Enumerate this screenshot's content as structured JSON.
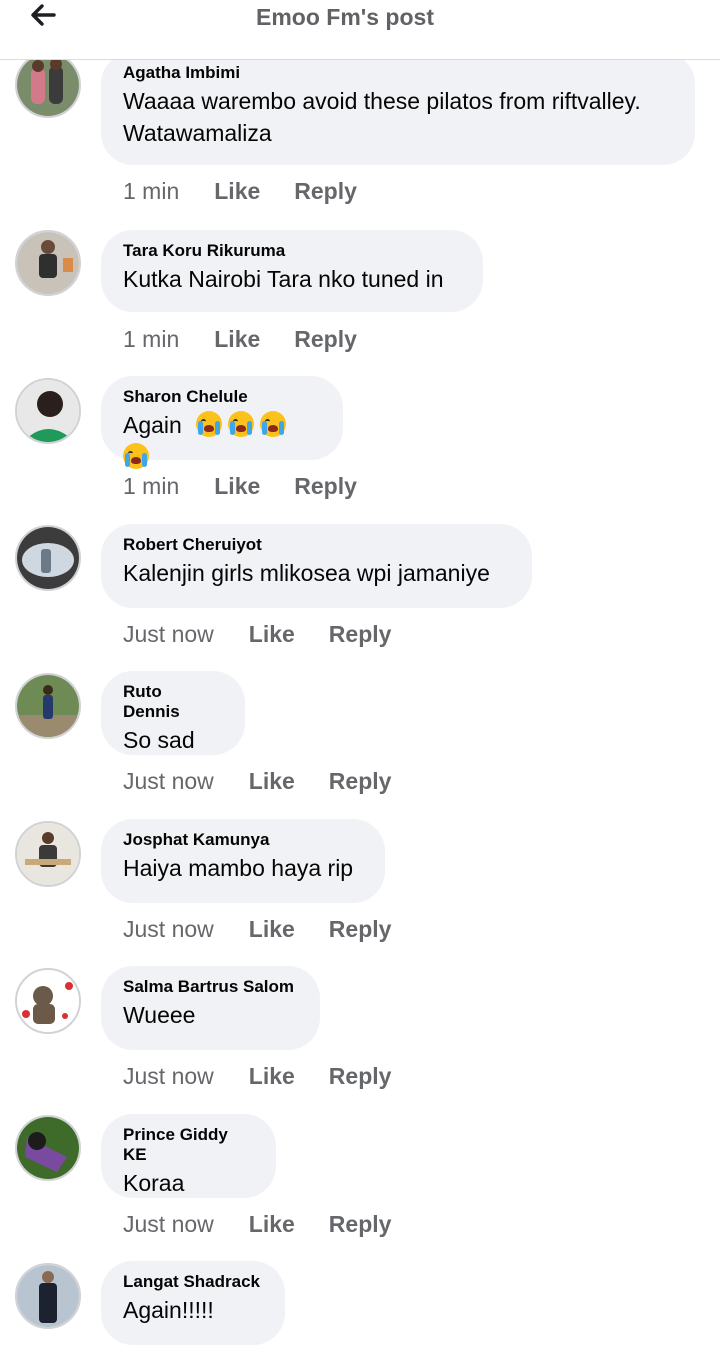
{
  "header": {
    "title": "Emoo Fm's post",
    "back_icon": "arrow-left-icon"
  },
  "actions": {
    "like": "Like",
    "reply": "Reply"
  },
  "comments": [
    {
      "author": "Agatha Imbimi",
      "lines": [
        "Waaaa warembo avoid these pilatos from riftvalley.",
        "Watawamaliza"
      ],
      "time": "1 min",
      "avatar_colors": [
        "#7a8c6a",
        "#d27a8a",
        "#3b3b3b"
      ]
    },
    {
      "author": "Tara Koru Rikuruma",
      "lines": [
        "Kutka Nairobi Tara nko tuned in"
      ],
      "time": "1 min",
      "avatar_colors": [
        "#c9c2b8",
        "#2f2f2f",
        "#d98b4a"
      ]
    },
    {
      "author": "Sharon Chelule",
      "lines": [
        "Again"
      ],
      "emoji_count": 4,
      "time": "1 min",
      "avatar_colors": [
        "#e8e8e8",
        "#2a1f1c",
        "#1f9a5a"
      ]
    },
    {
      "author": "Robert Cheruiyot",
      "lines": [
        "Kalenjin girls mlikosea wpi jamaniye"
      ],
      "time": "Just now",
      "avatar_colors": [
        "#3c3c3c",
        "#cfd8e0",
        "#6a7a88"
      ]
    },
    {
      "author": "Ruto Dennis",
      "lines": [
        "So sad"
      ],
      "time": "Just now",
      "avatar_colors": [
        "#6e8a55",
        "#9b8b6e",
        "#233a6a"
      ]
    },
    {
      "author": "Josphat Kamunya",
      "lines": [
        "Haiya mambo haya rip"
      ],
      "time": "Just now",
      "avatar_colors": [
        "#e9e6df",
        "#3a3a3a",
        "#c9a97a"
      ]
    },
    {
      "author": "Salma Bartrus Salom",
      "lines": [
        "Wueee"
      ],
      "time": "Just now",
      "avatar_colors": [
        "#ffffff",
        "#d93030",
        "#6b5a4a"
      ]
    },
    {
      "author": "Prince Giddy KE",
      "lines": [
        "Koraa"
      ],
      "time": "Just now",
      "avatar_colors": [
        "#3f6b2a",
        "#7a4aa0",
        "#1c1c1c"
      ]
    },
    {
      "author": "Langat Shadrack",
      "lines": [
        "Again!!!!!"
      ],
      "time": "Just now",
      "avatar_colors": [
        "#b8c4d0",
        "#1c2230",
        "#8a6a50"
      ]
    }
  ]
}
